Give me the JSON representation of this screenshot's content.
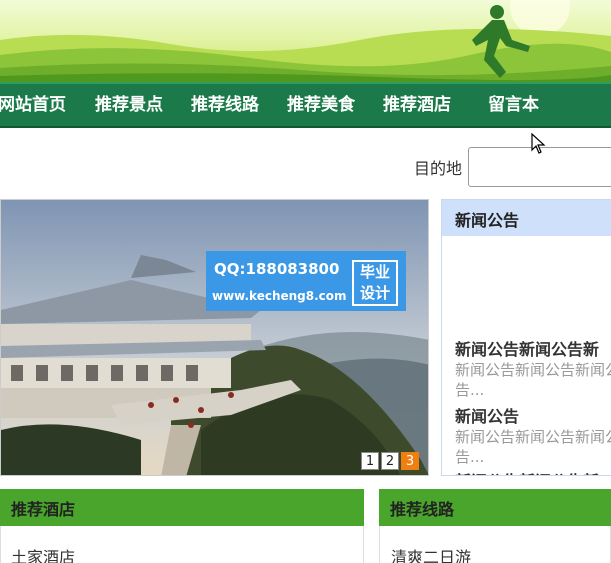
{
  "nav": {
    "items": [
      {
        "label": "网站首页"
      },
      {
        "label": "推荐景点"
      },
      {
        "label": "推荐线路"
      },
      {
        "label": "推荐美食"
      },
      {
        "label": "推荐酒店"
      },
      {
        "label": "留言本"
      }
    ]
  },
  "search": {
    "label": "目的地",
    "value": ""
  },
  "slider": {
    "watermark": {
      "qq": "QQ:188083800",
      "url": "www.kecheng8.com",
      "box_line1": "毕业",
      "box_line2": "设计"
    },
    "pages": [
      "1",
      "2",
      "3"
    ],
    "active_page": "3"
  },
  "news": {
    "title": "新闻公告",
    "items": [
      {
        "title": "新闻公告新闻公告新",
        "desc": "新闻公告新闻公告新闻公告..."
      },
      {
        "title": "新闻公告",
        "desc": "新闻公告新闻公告新闻公告..."
      },
      {
        "title": "新闻公告新闻公告新",
        "desc": ""
      }
    ]
  },
  "hotels": {
    "title": "推荐酒店",
    "items": [
      "土家酒店"
    ]
  },
  "routes": {
    "title": "推荐线路",
    "items": [
      "清爽二日游"
    ]
  },
  "colors": {
    "nav_bg": "#1c7a4a",
    "box_header": "#49a52b",
    "news_header": "#cfe0fb",
    "pager_active": "#f07f10",
    "watermark": "#3a98e6"
  }
}
